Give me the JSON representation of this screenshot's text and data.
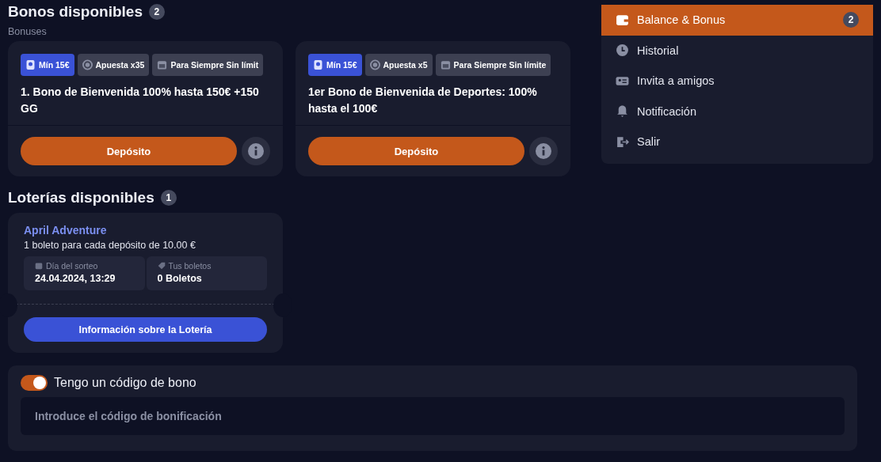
{
  "bonuses": {
    "title": "Bonos disponibles",
    "count": "2",
    "subtitle": "Bonuses",
    "cards": [
      {
        "chips": [
          {
            "kind": "min",
            "label": "Mín 15€"
          },
          {
            "kind": "wager",
            "label": "Apuesta x35"
          },
          {
            "kind": "duration",
            "label": "Para Siempre Sin límit"
          }
        ],
        "title": "1. Bono de Bienvenida 100% hasta 150€ +150 GG",
        "button": "Depósito"
      },
      {
        "chips": [
          {
            "kind": "min",
            "label": "Mín 15€"
          },
          {
            "kind": "wager",
            "label": "Apuesta x5"
          },
          {
            "kind": "duration",
            "label": "Para Siempre Sin límite"
          }
        ],
        "title": "1er Bono de Bienvenida de Deportes: 100% hasta el 100€",
        "button": "Depósito"
      }
    ]
  },
  "lotteries": {
    "title": "Loterías disponibles",
    "count": "1",
    "cards": [
      {
        "name": "April Adventure",
        "description": "1 boleto para cada depósito de 10.00 €",
        "draw_label": "Día del sorteo",
        "draw_value": "24.04.2024, 13:29",
        "tickets_label": "Tus boletos",
        "tickets_value": "0 Boletos",
        "button": "Información sobre la Lotería"
      }
    ]
  },
  "menu": {
    "items": [
      {
        "kind": "wallet",
        "label": "Balance & Bonus",
        "badge": "2",
        "selected": true
      },
      {
        "kind": "clock",
        "label": "Historial",
        "selected": false
      },
      {
        "kind": "card",
        "label": "Invita a amigos",
        "selected": false
      },
      {
        "kind": "bell",
        "label": "Notificación",
        "selected": false
      },
      {
        "kind": "exit",
        "label": "Salir",
        "selected": false
      }
    ]
  },
  "bonus_code": {
    "toggle_label": "Tengo un código de bono",
    "on": true,
    "placeholder": "Introduce el código de bonificación"
  }
}
